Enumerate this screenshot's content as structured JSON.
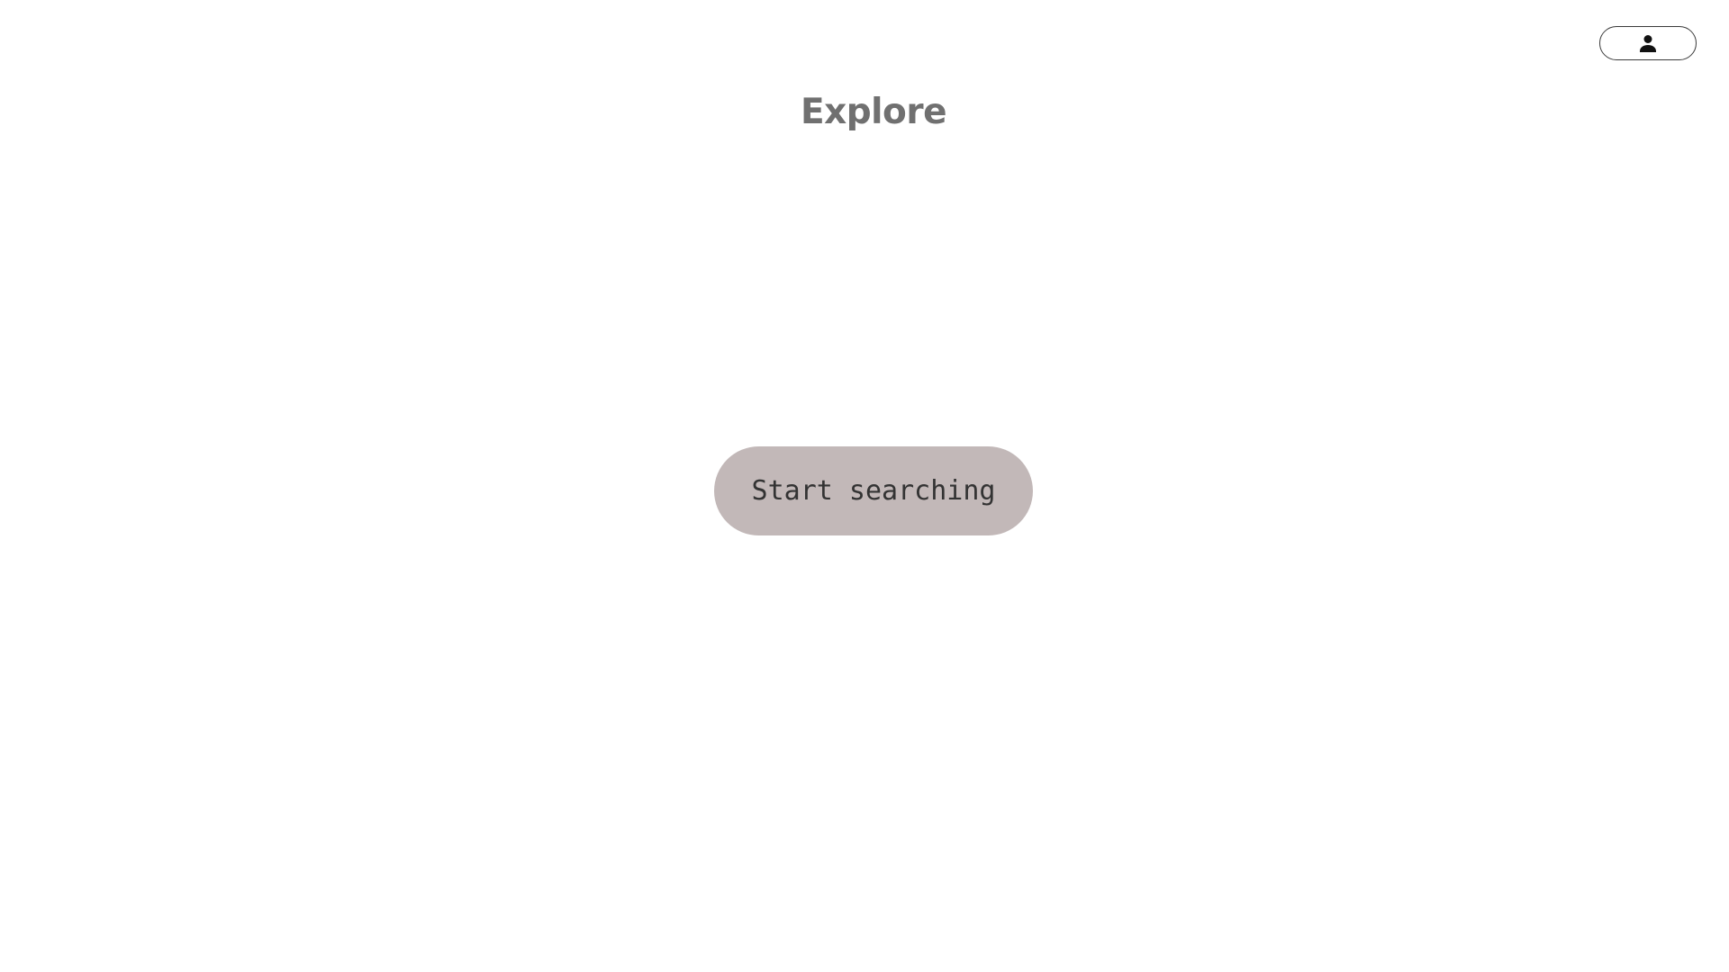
{
  "header": {
    "title": "Explore",
    "account_icon": "user-icon"
  },
  "main": {
    "start_button_label": "Start searching"
  },
  "colors": {
    "background": "#ffffff",
    "title": "#707070",
    "start_button_bg": "#c2b8b8",
    "start_button_text": "#333333",
    "account_border": "#3a3a3a"
  }
}
